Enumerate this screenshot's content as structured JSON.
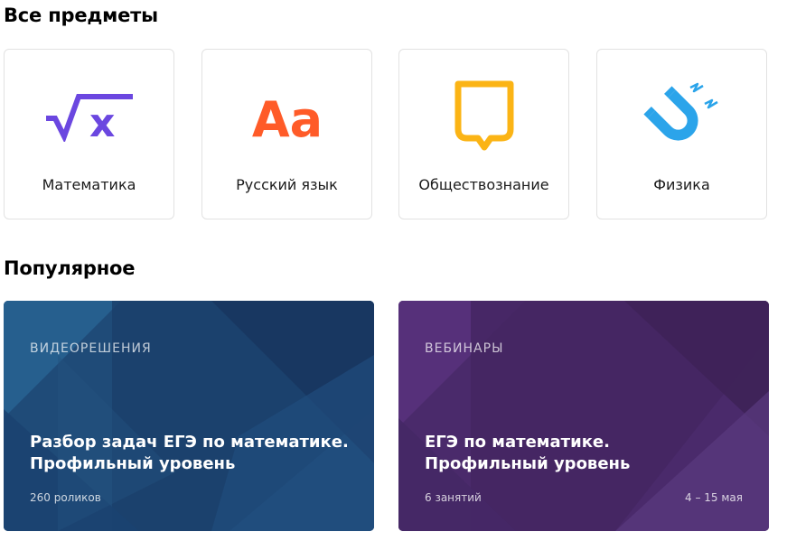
{
  "sections": {
    "subjects_title": "Все предметы",
    "popular_title": "Популярное"
  },
  "subjects": [
    {
      "label": "Математика",
      "icon": "sqrt-x-icon",
      "color": "#6b47e0"
    },
    {
      "label": "Русский язык",
      "icon": "aa-letters-icon",
      "color": "#ff5b28"
    },
    {
      "label": "Обществознание",
      "icon": "shield-icon",
      "color": "#fbb415"
    },
    {
      "label": "Физика",
      "icon": "magnet-icon",
      "color": "#2ba4ea"
    }
  ],
  "icon_text": {
    "math": "√x",
    "russian": "Aa"
  },
  "popular": [
    {
      "kicker": "ВИДЕОРЕШЕНИЯ",
      "title_line1": "Разбор задач ЕГЭ по математике.",
      "title_line2": "Профильный уровень",
      "meta": "260 роликов",
      "meta_right": "",
      "color": "#1f4b78"
    },
    {
      "kicker": "ВЕБИНАРЫ",
      "title_line1": "ЕГЭ по математике.",
      "title_line2": "Профильный уровень",
      "meta": "6 занятий",
      "meta_right": "4 – 15 мая",
      "color": "#4a2a6b"
    }
  ]
}
